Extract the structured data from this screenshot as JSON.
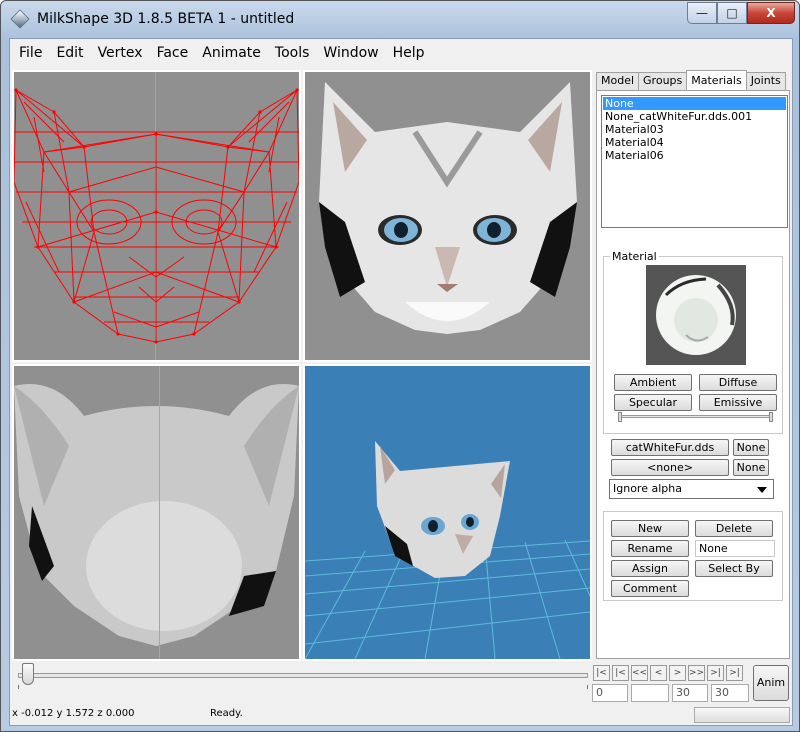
{
  "window": {
    "title": "MilkShape 3D 1.8.5 BETA 1 - untitled",
    "minimize": "—",
    "maximize": "□",
    "close": "X"
  },
  "menu": [
    "File",
    "Edit",
    "Vertex",
    "Face",
    "Animate",
    "Tools",
    "Window",
    "Help"
  ],
  "viewports": {
    "top_left": "front-wireframe",
    "top_right": "front-textured",
    "bottom_left": "back-textured",
    "bottom_right": "perspective-3d"
  },
  "tabs": [
    "Model",
    "Groups",
    "Materials",
    "Joints"
  ],
  "active_tab": "Materials",
  "materials": {
    "list": [
      "None",
      "None_catWhiteFur.dds.001",
      "Material03",
      "Material04",
      "Material06"
    ],
    "selected": "None",
    "group_title": "Material",
    "ambient": "Ambient",
    "diffuse": "Diffuse",
    "specular": "Specular",
    "emissive": "Emissive",
    "texture": "catWhiteFur.dds",
    "texture_none": "None",
    "alpha_map": "<none>",
    "alpha_none": "None",
    "alpha_mode": "Ignore alpha",
    "new": "New",
    "delete": "Delete",
    "rename": "Rename",
    "name_value": "None",
    "assign": "Assign",
    "select_by": "Select By",
    "comment": "Comment"
  },
  "timeline": {
    "buttons": [
      "|<",
      "|<",
      "<<",
      "<",
      ">",
      ">>",
      ">|",
      ">|"
    ],
    "current_frame": "0",
    "start_frame": "",
    "end_frame_1": "30",
    "end_frame_2": "30",
    "anim": "Anim"
  },
  "status": {
    "coords": "x -0.012 y 1.572 z 0.000",
    "message": "Ready."
  },
  "colors": {
    "wireframe": "#ff0000",
    "axis": "#2fd6e6",
    "viewport_bg": "#909090",
    "perspective_bg": "#3a7fb6",
    "selection": "#3399ff"
  }
}
